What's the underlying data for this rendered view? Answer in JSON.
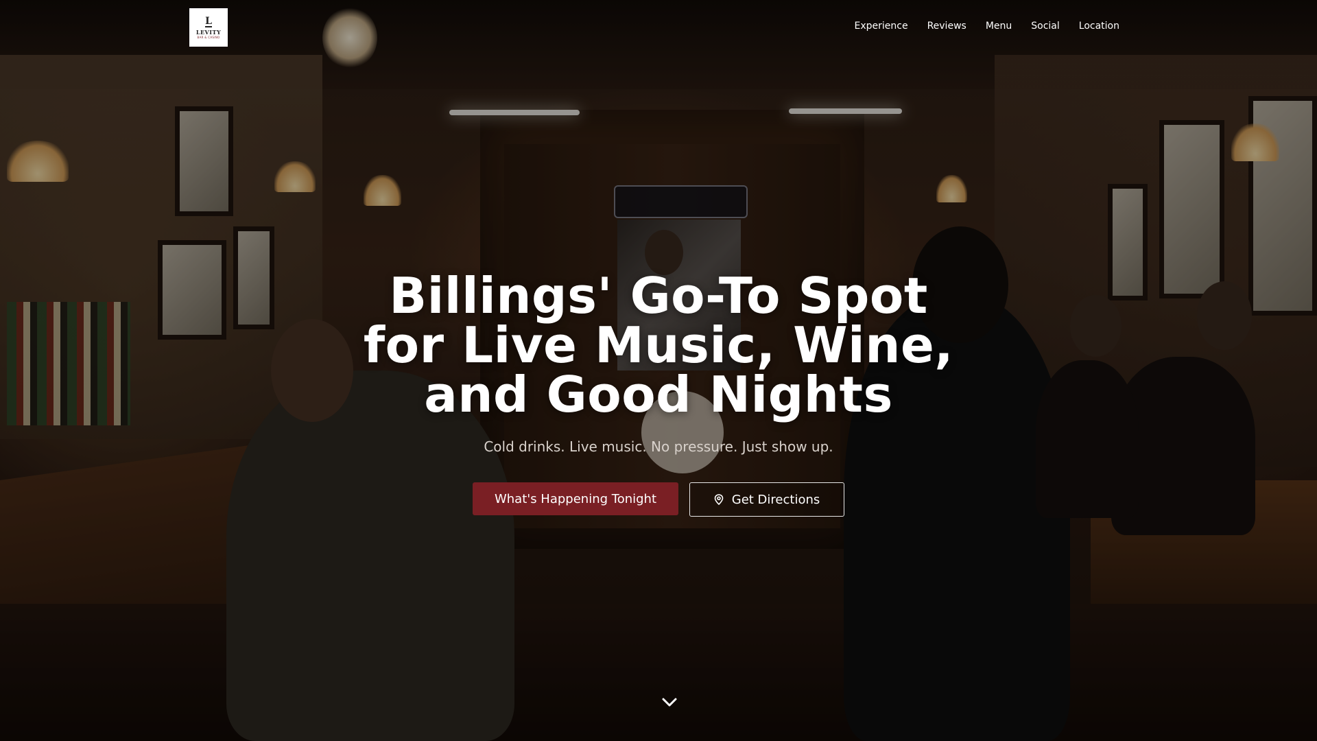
{
  "header": {
    "logo": {
      "mark": "L",
      "name": "LEVITY",
      "sub": "BAR & CASINO"
    },
    "nav": [
      {
        "label": "Experience"
      },
      {
        "label": "Reviews"
      },
      {
        "label": "Menu"
      },
      {
        "label": "Social"
      },
      {
        "label": "Location"
      }
    ]
  },
  "hero": {
    "title_lines": [
      "Billings' Go-To Spot",
      "for Live Music, Wine,",
      "and Good Nights"
    ],
    "subtitle": "Cold drinks. Live music. No pressure. Just show up.",
    "primary_cta": "What's Happening Tonight",
    "secondary_cta": "Get Directions",
    "secondary_cta_icon": "map-pin-icon",
    "scroll_icon": "chevron-down-icon"
  },
  "colors": {
    "accent": "#7a1f24",
    "text": "#ffffff",
    "subtitle": "#d9d2cc"
  }
}
